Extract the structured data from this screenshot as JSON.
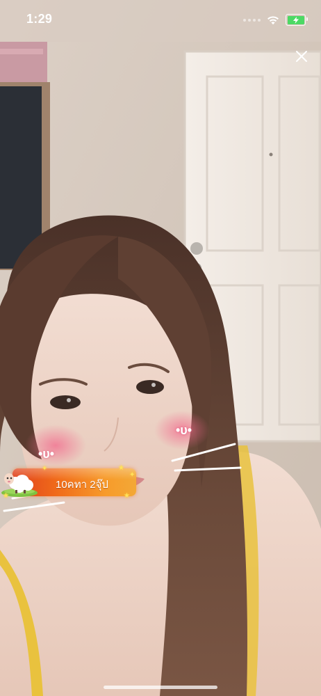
{
  "status_bar": {
    "time": "1:29",
    "battery_level": 1.0,
    "battery_charging": true,
    "wifi_icon": "wifi-icon",
    "battery_icon": "battery-charging-icon",
    "battery_color": "#4cd964"
  },
  "controls": {
    "close_icon": "close-icon"
  },
  "gift_banner": {
    "text": "10คทา 2จุ๊ป",
    "gift_icon": "sheep-gift-icon",
    "colors": {
      "start": "#e0421d",
      "end": "#f3a836",
      "sparkle": "#ffe15c"
    }
  },
  "face_filter": {
    "left_cheek_text": "•υ•",
    "right_cheek_text": "•υ•",
    "blush_color": "#f26a8d",
    "whisker_color": "#ffffff"
  }
}
